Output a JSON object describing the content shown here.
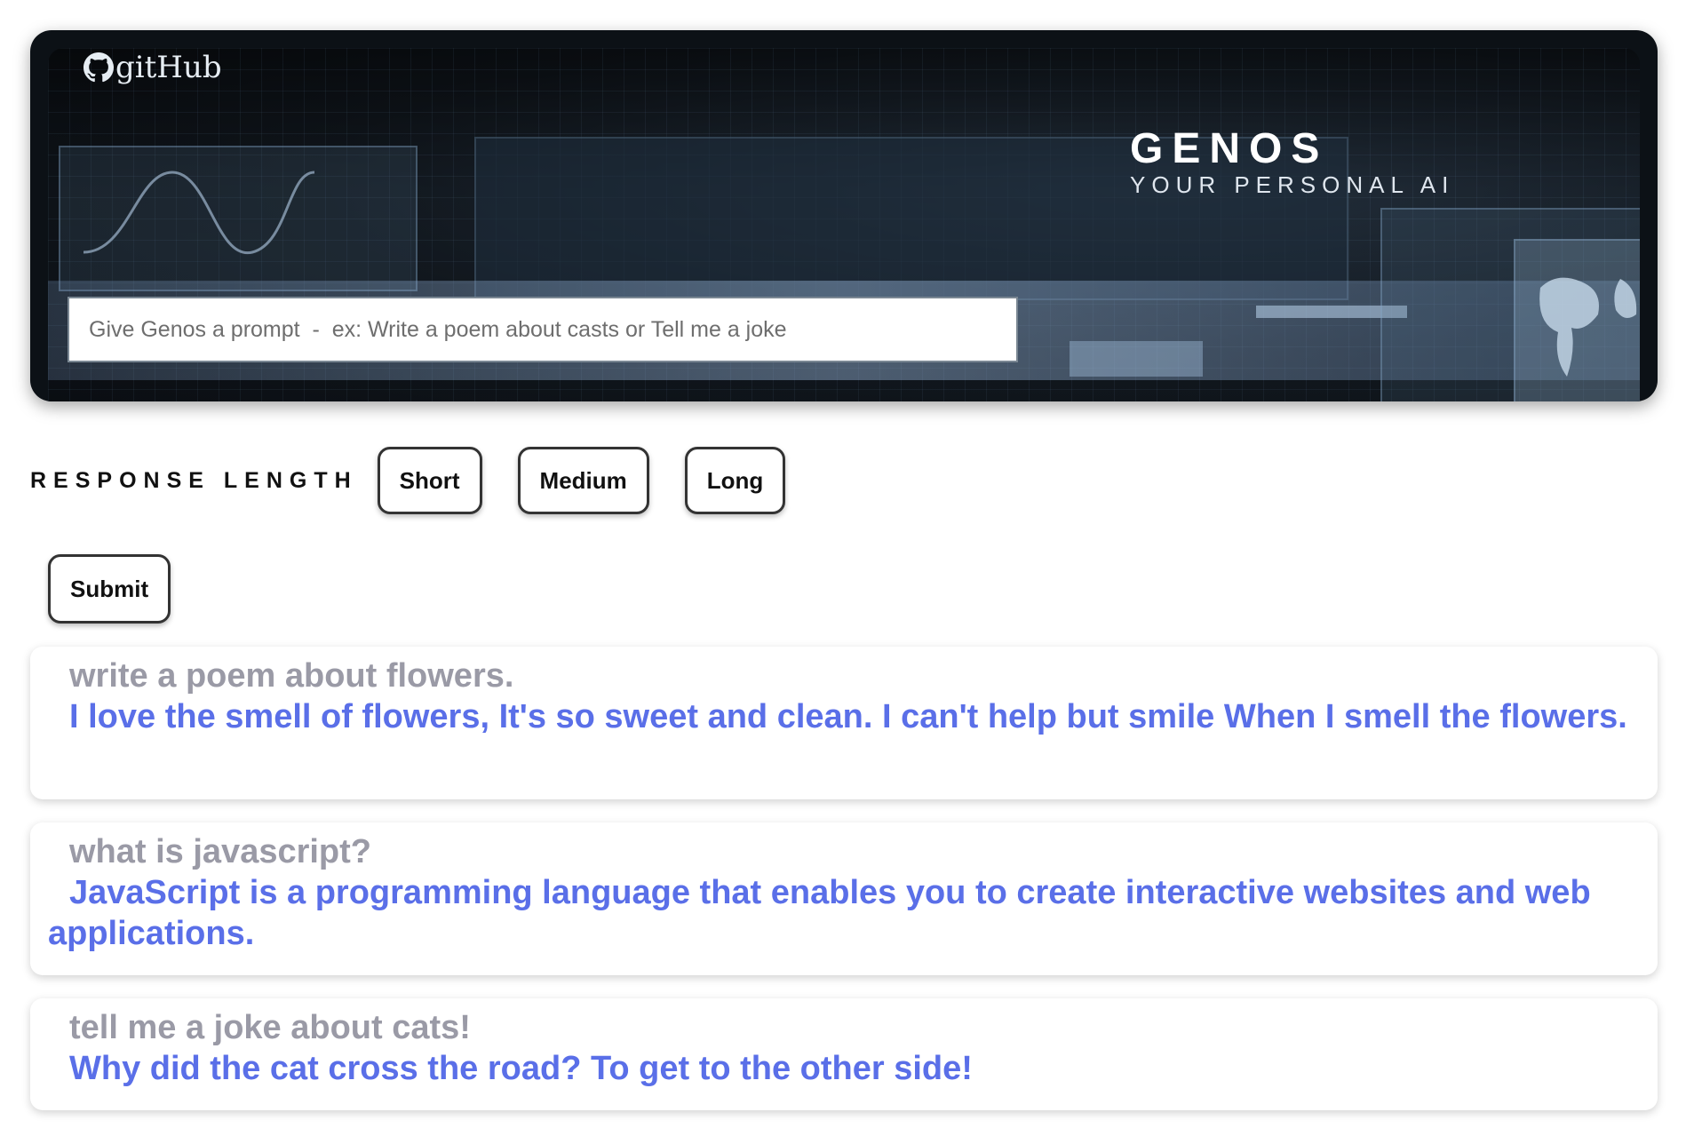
{
  "header": {
    "logo_text": "gitHub",
    "title": "GENOS",
    "subtitle": "YOUR PERSONAL AI",
    "prompt_placeholder": "Give Genos a prompt  -  ex: Write a poem about casts or Tell me a joke",
    "prompt_value": ""
  },
  "controls": {
    "length_label": "RESPONSE LENGTH",
    "options": [
      "Short",
      "Medium",
      "Long"
    ],
    "submit_label": "Submit"
  },
  "responses": [
    {
      "prompt": "write a poem about flowers.",
      "answer": "I love the smell of flowers, It's so sweet and clean. I can't help but smile When I smell the flowers."
    },
    {
      "prompt": "what is javascript?",
      "answer": "JavaScript is a programming language that enables you to create interactive websites and web applications."
    },
    {
      "prompt": "tell me a joke about cats!",
      "answer": "Why did the cat cross the road? To get to the other side!"
    }
  ],
  "colors": {
    "prompt_text": "#9a9aa6",
    "answer_text": "#5a6fe8"
  }
}
